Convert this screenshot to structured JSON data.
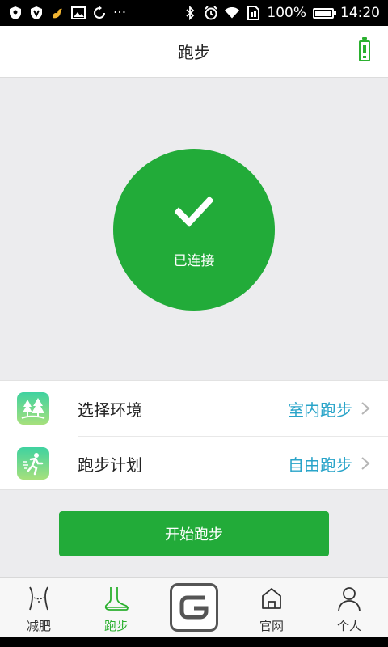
{
  "status_bar": {
    "battery_percent": "100%",
    "time": "14:20",
    "more": "···"
  },
  "header": {
    "title": "跑步"
  },
  "connection": {
    "label": "已连接"
  },
  "settings": [
    {
      "label": "选择环境",
      "value": "室内跑步",
      "icon": "forest-icon"
    },
    {
      "label": "跑步计划",
      "value": "自由跑步",
      "icon": "runner-icon"
    }
  ],
  "start_button": {
    "label": "开始跑步"
  },
  "bottom_nav": [
    {
      "label": "减肥",
      "icon": "waist-icon",
      "active": false
    },
    {
      "label": "跑步",
      "icon": "foot-icon",
      "active": true
    },
    {
      "label": "",
      "icon": "brand-logo-icon",
      "active": false
    },
    {
      "label": "官网",
      "icon": "home-icon",
      "active": false
    },
    {
      "label": "个人",
      "icon": "person-icon",
      "active": false
    }
  ],
  "colors": {
    "accent_green": "#22ab39",
    "value_blue": "#29a4c9",
    "background": "#ececee"
  }
}
